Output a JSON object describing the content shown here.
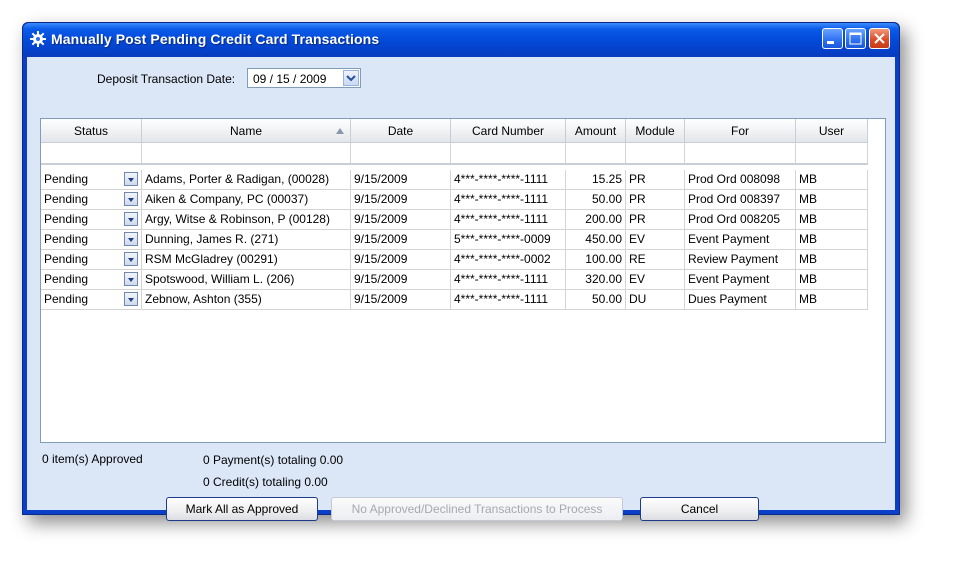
{
  "window": {
    "title": "Manually Post Pending Credit Card Transactions"
  },
  "deposit": {
    "label": "Deposit Transaction Date:",
    "value": "09 / 15 / 2009"
  },
  "grid": {
    "columns": [
      "Status",
      "Name",
      "Date",
      "Card Number",
      "Amount",
      "Module",
      "For",
      "User"
    ],
    "sorted_column": "Name",
    "rows": [
      {
        "status": "Pending",
        "name": "Adams, Porter & Radigan, (00028)",
        "date": "9/15/2009",
        "card": "4***-****-****-1111",
        "amount": "15.25",
        "module": "PR",
        "for": "Prod Ord 008098",
        "user": "MB"
      },
      {
        "status": "Pending",
        "name": "Aiken & Company, PC (00037)",
        "date": "9/15/2009",
        "card": "4***-****-****-1111",
        "amount": "50.00",
        "module": "PR",
        "for": "Prod Ord 008397",
        "user": "MB"
      },
      {
        "status": "Pending",
        "name": "Argy, Witse & Robinson, P (00128)",
        "date": "9/15/2009",
        "card": "4***-****-****-1111",
        "amount": "200.00",
        "module": "PR",
        "for": "Prod Ord 008205",
        "user": "MB"
      },
      {
        "status": "Pending",
        "name": "Dunning, James R. (271)",
        "date": "9/15/2009",
        "card": "5***-****-****-0009",
        "amount": "450.00",
        "module": "EV",
        "for": "Event Payment",
        "user": "MB"
      },
      {
        "status": "Pending",
        "name": "RSM McGladrey (00291)",
        "date": "9/15/2009",
        "card": "4***-****-****-0002",
        "amount": "100.00",
        "module": "RE",
        "for": "Review Payment",
        "user": "MB"
      },
      {
        "status": "Pending",
        "name": "Spotswood, William L. (206)",
        "date": "9/15/2009",
        "card": "4***-****-****-1111",
        "amount": "320.00",
        "module": "EV",
        "for": "Event Payment",
        "user": "MB"
      },
      {
        "status": "Pending",
        "name": "Zebnow, Ashton (355)",
        "date": "9/15/2009",
        "card": "4***-****-****-1111",
        "amount": "50.00",
        "module": "DU",
        "for": "Dues Payment",
        "user": "MB"
      }
    ]
  },
  "summary": {
    "approved": "0 item(s) Approved",
    "payments": "0 Payment(s) totaling 0.00",
    "credits": "0 Credit(s) totaling 0.00"
  },
  "buttons": {
    "mark_all": "Mark All as Approved",
    "process": "No Approved/Declined Transactions to Process",
    "cancel": "Cancel"
  },
  "colors": {
    "titlebar": "#0348d6",
    "client_bg": "#dbe6f7",
    "close_button": "#de4d27"
  },
  "icons": [
    "gear-icon",
    "minimize-icon",
    "maximize-icon",
    "close-icon",
    "calendar-dropdown-icon",
    "sort-ascending-icon",
    "dropdown-arrow-icon"
  ]
}
